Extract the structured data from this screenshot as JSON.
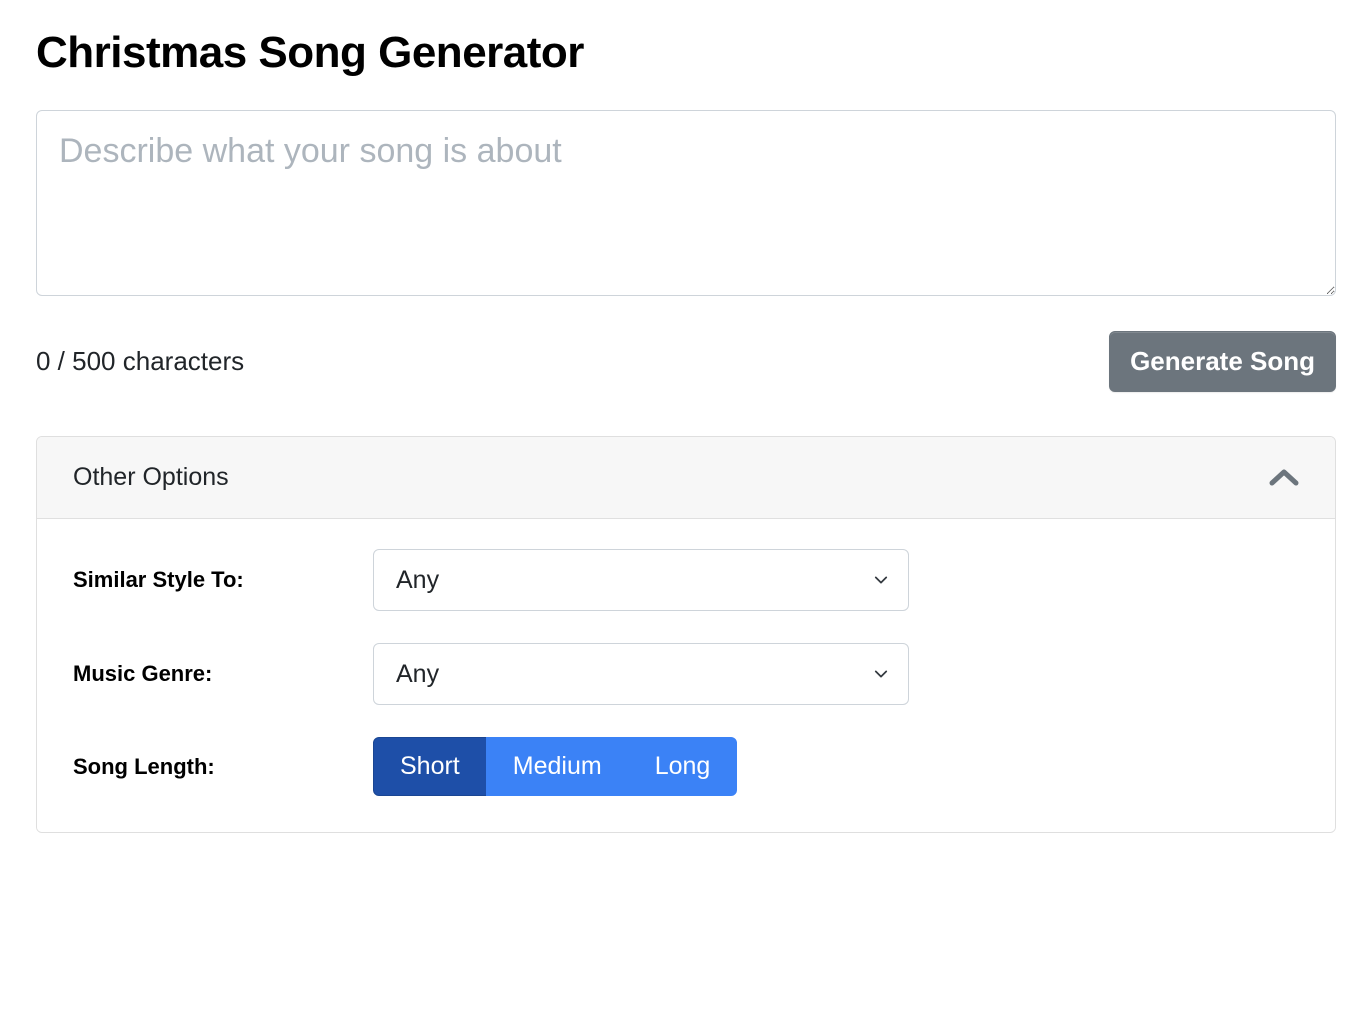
{
  "header": {
    "title": "Christmas Song Generator"
  },
  "input": {
    "placeholder": "Describe what your song is about",
    "value": ""
  },
  "counter": {
    "text": "0 / 500 characters"
  },
  "actions": {
    "generate_label": "Generate Song"
  },
  "options": {
    "panel_title": "Other Options",
    "style": {
      "label": "Similar Style To:",
      "selected": "Any"
    },
    "genre": {
      "label": "Music Genre:",
      "selected": "Any"
    },
    "length": {
      "label": "Song Length:",
      "choices": [
        "Short",
        "Medium",
        "Long"
      ],
      "active": "Short"
    }
  }
}
